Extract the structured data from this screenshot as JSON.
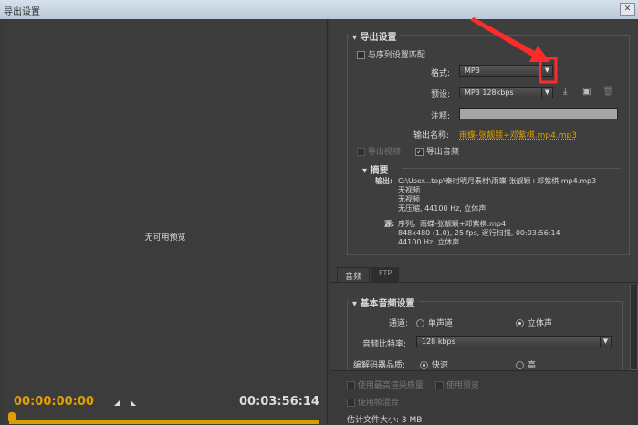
{
  "window": {
    "title": "导出设置",
    "close_icon": "close-icon"
  },
  "preview": {
    "no_preview": "无可用预览",
    "current_time": "00:00:00:00",
    "duration": "00:03:56:14"
  },
  "export_settings": {
    "section_title": "导出设置",
    "match_sequence": "与序列设置匹配",
    "format_label": "格式:",
    "format_value": "MP3",
    "preset_label": "预设:",
    "preset_value": "MP3 128kbps",
    "comment_label": "注释:",
    "comment_value": "",
    "output_name_label": "输出名称:",
    "output_name": "雨蝶-张靓颖+邓紫棋.mp4.mp3",
    "export_video": "导出视频",
    "export_audio": "导出音频",
    "export_audio_checked": true,
    "summary_title": "摘要",
    "output_label": "输出:",
    "output_lines": [
      "C:\\User...top\\秦时明月素材\\雨蝶-张靓颖+邓紫棋.mp4.mp3",
      "无视频",
      "无视频",
      "无压缩, 44100 Hz, 立体声"
    ],
    "source_label": "源:",
    "source_lines": [
      "序列，雨蝶-张靓颖+邓紫棋.mp4",
      "848x480 (1.0), 25 fps, 逐行扫描, 00:03:56:14",
      "44100 Hz, 立体声"
    ]
  },
  "tabs": [
    {
      "label": "音频",
      "active": true
    },
    {
      "label": "FTP",
      "active": false
    }
  ],
  "audio": {
    "section_title": "基本音频设置",
    "channel_label": "通道:",
    "mono": "单声道",
    "stereo": "立体声",
    "channel_selected": "立体声",
    "bitrate_label": "音频比特率:",
    "bitrate_value": "128 kbps",
    "quality_label": "编解码器品质:",
    "fast": "快速",
    "high": "高",
    "quality_selected": "快速"
  },
  "bottom": {
    "max_quality": "使用最高渲染质量",
    "use_preview": "使用预览",
    "frame_blend": "使用帧混合",
    "file_size": "估计文件大小: 3 MB"
  },
  "colors": {
    "accent": "#e0a000",
    "annotation": "#ff2a2a"
  }
}
